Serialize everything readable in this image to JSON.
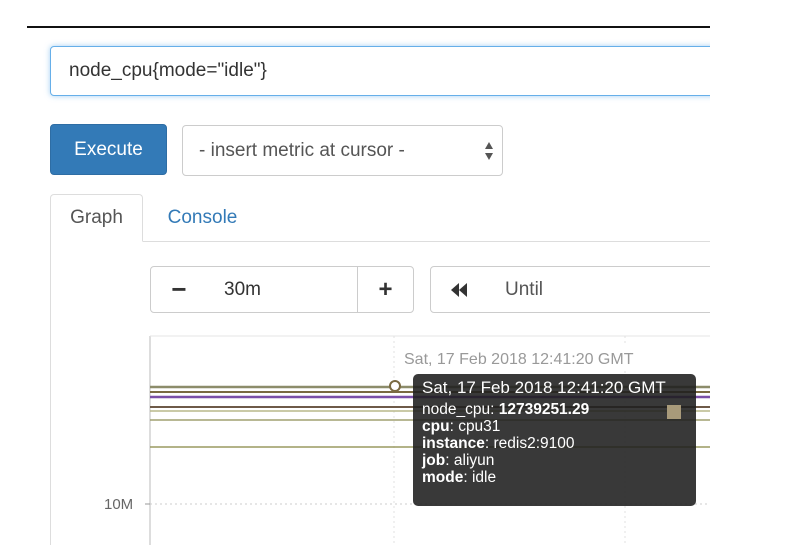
{
  "query": {
    "value": "node_cpu{mode=\"idle\"}"
  },
  "toolbar": {
    "execute_label": "Execute",
    "insert_metric_label": "- insert metric at cursor -"
  },
  "tabs": [
    {
      "label": "Graph",
      "active": true
    },
    {
      "label": "Console",
      "active": false
    }
  ],
  "graph_controls": {
    "minus_label": "−",
    "range_value": "30m",
    "plus_label": "+",
    "back_icon": "double-chevron-left-icon",
    "until_placeholder": "Until"
  },
  "graph": {
    "hover_time_label": "Sat, 17 Feb 2018 12:41:20 GMT",
    "y_axis_label": "10M",
    "series_colors": [
      "#8c8c6a",
      "#7a6a42",
      "#7b4fa8",
      "#6e5a48",
      "#b8b88a",
      "#a0a070",
      "#9a9a60"
    ]
  },
  "tooltip": {
    "date": "Sat, 17 Feb 2018 12:41:20 GMT",
    "metric_key": "node_cpu",
    "metric_value": "12739251.29",
    "labels": [
      {
        "key": "cpu",
        "value": "cpu31"
      },
      {
        "key": "instance",
        "value": "redis2:9100"
      },
      {
        "key": "job",
        "value": "aliyun"
      },
      {
        "key": "mode",
        "value": "idle"
      }
    ],
    "swatch_color": "#a89a7a"
  }
}
